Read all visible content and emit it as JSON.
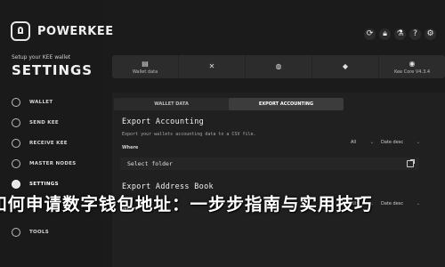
{
  "app": {
    "logo_text": "POWERKEE",
    "setup_subtitle": "Setup your KEE wallet",
    "settings_title": "SETTINGS"
  },
  "sidebar": {
    "items": [
      {
        "label": "WALLET",
        "icon": "wallet-icon"
      },
      {
        "label": "SEND KEE",
        "icon": "send-icon"
      },
      {
        "label": "RECEIVE KEE",
        "icon": "receive-icon"
      },
      {
        "label": "MASTER NODES",
        "icon": "nodes-icon"
      },
      {
        "label": "SETTINGS",
        "icon": "settings-icon"
      },
      {
        "label": "TOOLS",
        "icon": "tools-icon"
      }
    ]
  },
  "topbar": {
    "icons": [
      "refresh-icon",
      "lock-icon",
      "flask-icon",
      "help-icon",
      "settings-icon"
    ]
  },
  "tabs": [
    {
      "label": "Wallet data",
      "icon": "wallet-data-icon"
    },
    {
      "label": "",
      "icon": "tools-icon"
    },
    {
      "label": "",
      "icon": "user-icon"
    },
    {
      "label": "",
      "icon": "shield-icon"
    },
    {
      "label": "Kee Core V4.3.4",
      "icon": "kee-core-icon"
    }
  ],
  "subtabs": [
    "WALLET DATA",
    "EXPORT ACCOUNTING"
  ],
  "export_accounting": {
    "title": "Export Accounting",
    "description": "Export your wallets accounting data to a CSV file.",
    "where_label": "Where",
    "filter_all": "All",
    "sort": "Date desc",
    "folder_placeholder": "Select folder"
  },
  "export_address_book": {
    "title": "Export Address Book",
    "where_label": "Where",
    "filter_all": "All",
    "sort": "Date desc"
  },
  "overlay_text": "如何申请数字钱包地址：一步步指南与实用技巧"
}
